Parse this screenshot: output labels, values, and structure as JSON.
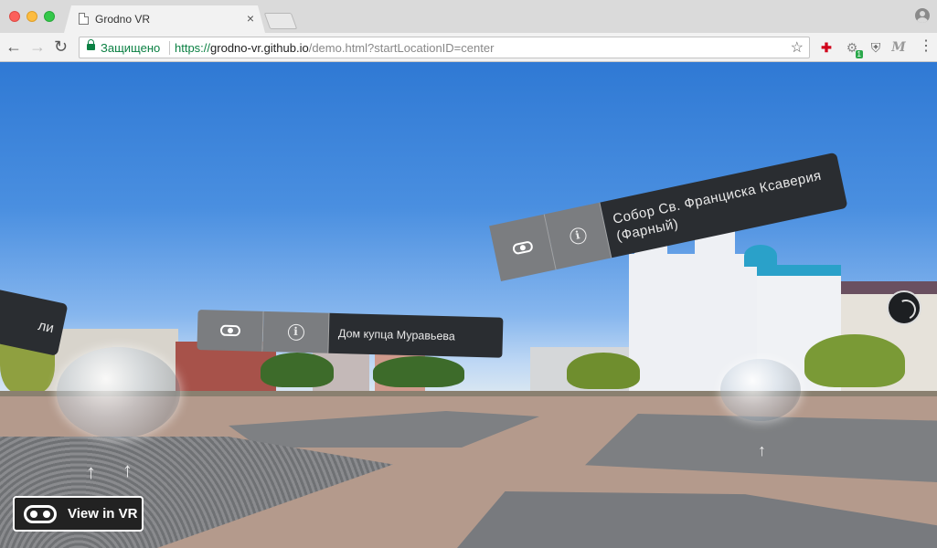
{
  "browser": {
    "tab_title": "Grodno VR",
    "tab_close": "×",
    "address": {
      "secure_label": "Защищено",
      "scheme": "https://",
      "host": "grodno-vr.github.io",
      "path": "/demo.html?startLocationID=center"
    },
    "extension_badge": "1"
  },
  "scene": {
    "labels": {
      "left_partial": "ли",
      "middle": "Дом купца Муравьева",
      "right": "Собор Св. Франциска Ксаверия (Фарный)"
    },
    "info_glyph": "i",
    "vr_button_label": "View in VR"
  },
  "colors": {
    "panel_dark": "#2a2d31",
    "panel_button": "#7b7d80",
    "secure_green": "#0b8043"
  }
}
